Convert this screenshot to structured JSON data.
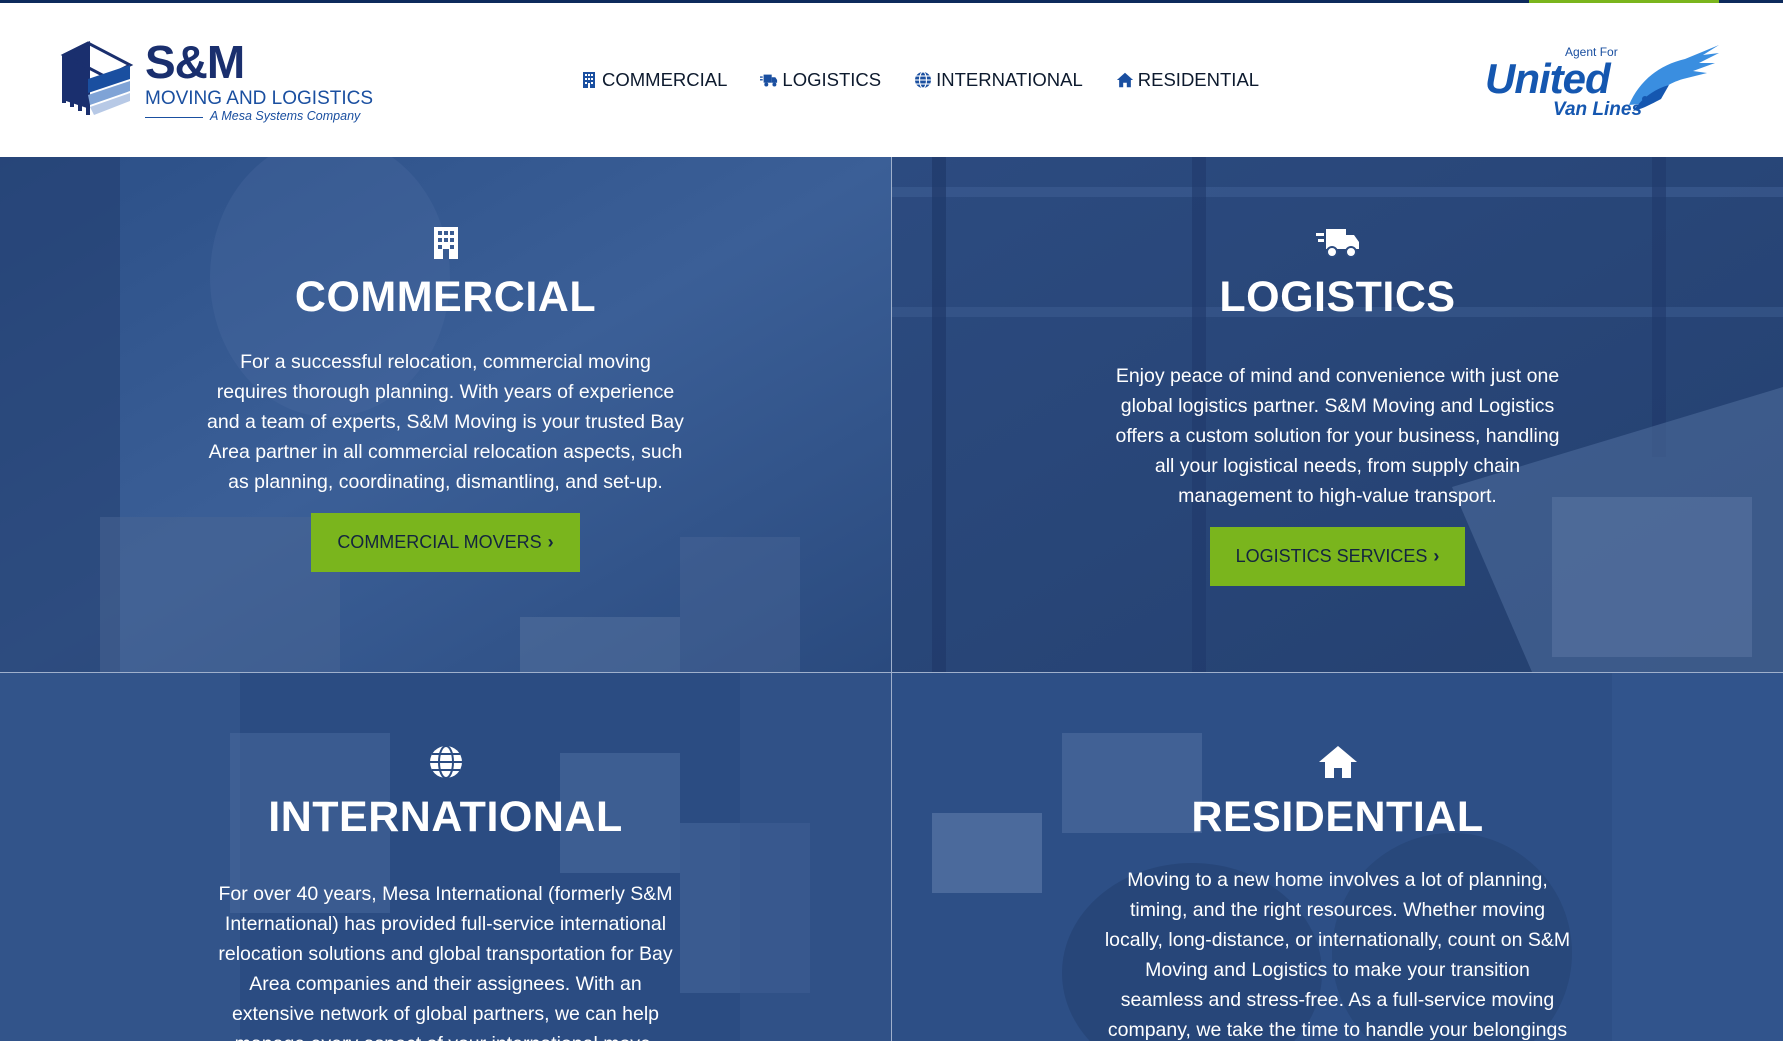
{
  "header": {
    "logo": {
      "name": "S&M",
      "subtitle": "MOVING AND LOGISTICS",
      "tagline": "A Mesa Systems Company"
    },
    "nav": [
      {
        "label": "COMMERCIAL",
        "icon": "building-icon"
      },
      {
        "label": "LOGISTICS",
        "icon": "truck-fast-icon"
      },
      {
        "label": "INTERNATIONAL",
        "icon": "globe-icon"
      },
      {
        "label": "RESIDENTIAL",
        "icon": "home-icon"
      }
    ],
    "agent": {
      "prefix": "Agent For",
      "brand": "United",
      "brand_sub": "Van Lines"
    }
  },
  "panels": {
    "commercial": {
      "icon": "building-icon",
      "title": "COMMERCIAL",
      "text": "For a successful relocation, commercial moving requires thorough planning. With years of experience and a team of experts, S&M Moving is your trusted Bay Area partner in all commercial relocation aspects, such as planning, coordinating, dismantling, and set-up.",
      "button": "COMMERCIAL MOVERS"
    },
    "logistics": {
      "icon": "truck-fast-icon",
      "title": "LOGISTICS",
      "text": "Enjoy peace of mind and convenience with just one global logistics partner. S&M Moving and Logistics offers a custom solution for your business, handling all your logistical needs, from supply chain management to high-value transport.",
      "button": "LOGISTICS SERVICES"
    },
    "international": {
      "icon": "globe-icon",
      "title": "INTERNATIONAL",
      "text": "For over 40 years, Mesa International (formerly S&M International) has provided full-service international relocation solutions and global transportation for Bay Area companies and their assignees. With an extensive network of global partners, we can help manage every aspect of your international move."
    },
    "residential": {
      "icon": "home-icon",
      "title": "RESIDENTIAL",
      "text": "Moving to a new home involves a lot of planning, timing, and the right resources. Whether moving locally, long-distance, or internationally, count on S&M Moving and Logistics to make your transition seamless and stress-free. As a full-service moving company, we take the time to handle your belongings"
    }
  },
  "colors": {
    "navy": "#0d2a5c",
    "brand_blue": "#1a4fa0",
    "accent_green": "#7ab51d",
    "overlay_blue": "#2a4f8a"
  }
}
